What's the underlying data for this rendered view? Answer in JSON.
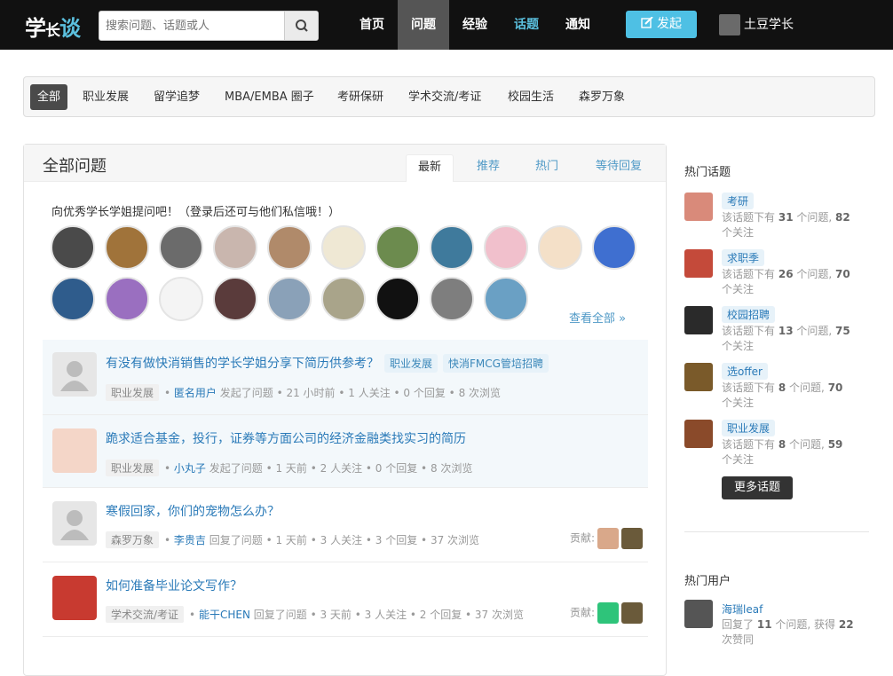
{
  "header": {
    "logo": {
      "a": "学",
      "b": "长",
      "c": "谈"
    },
    "search_placeholder": "搜索问题、话题或人",
    "nav": [
      "首页",
      "问题",
      "经验",
      "话题",
      "通知"
    ],
    "post_label": "发起",
    "username": "土豆学长",
    "accent_color": "#4ec0e4"
  },
  "categories": [
    "全部",
    "职业发展",
    "留学追梦",
    "MBA/EMBA 圈子",
    "考研保研",
    "学术交流/考证",
    "校园生活",
    "森罗万象"
  ],
  "panel": {
    "title": "全部问题",
    "tabs": [
      "最新",
      "推荐",
      "热门",
      "等待回复"
    ],
    "prompt": "向优秀学长学姐提问吧！（登录后还可与他们私信哦！）",
    "view_all": "查看全部 »"
  },
  "questions": [
    {
      "title": "有没有做快消销售的学长学姐分享下简历供参考？",
      "tags": [
        "职业发展",
        "快消FMCG管培招聘"
      ],
      "category": "职业发展",
      "author": "匿名用户",
      "stats": "发起了问题 • 21 小时前 • 1 人关注 • 0 个回复 • 8 次浏览"
    },
    {
      "title": "跪求适合基金，投行，证券等方面公司的经济金融类找实习的简历",
      "tags": [],
      "category": "职业发展",
      "author": "小丸子",
      "stats": "发起了问题 • 1 天前 • 2 人关注 • 0 个回复 • 8 次浏览"
    },
    {
      "title": "寒假回家，你们的宠物怎么办？",
      "tags": [],
      "category": "森罗万象",
      "author": "李贵吉",
      "stats": "回复了问题 • 1 天前 • 3 人关注 • 3 个回复 • 37 次浏览",
      "contrib_label": "贡献:"
    },
    {
      "title": "如何准备毕业论文写作？",
      "tags": [],
      "category": "学术交流/考证",
      "author": "能干CHEN",
      "stats": "回复了问题 • 3 天前 • 3 人关注 • 2 个回复 • 37 次浏览",
      "contrib_label": "贡献:"
    }
  ],
  "sidebar": {
    "hot_topics_title": "热门话题",
    "topics": [
      {
        "name": "考研",
        "q": "31",
        "f": "82"
      },
      {
        "name": "求职季",
        "q": "26",
        "f": "70"
      },
      {
        "name": "校园招聘",
        "q": "13",
        "f": "75"
      },
      {
        "name": "选offer",
        "q": "8",
        "f": "70"
      },
      {
        "name": "职业发展",
        "q": "8",
        "f": "59"
      }
    ],
    "topic_text": {
      "a": "该话题下有",
      "b": "个问题,",
      "c": "个关注"
    },
    "more_topics": "更多话题",
    "hot_users_title": "热门用户",
    "hot_user": {
      "name": "海瑞leaf",
      "a": "回复了",
      "q": "11",
      "b": "个问题, 获得",
      "v": "22",
      "c": "次赞同"
    }
  }
}
